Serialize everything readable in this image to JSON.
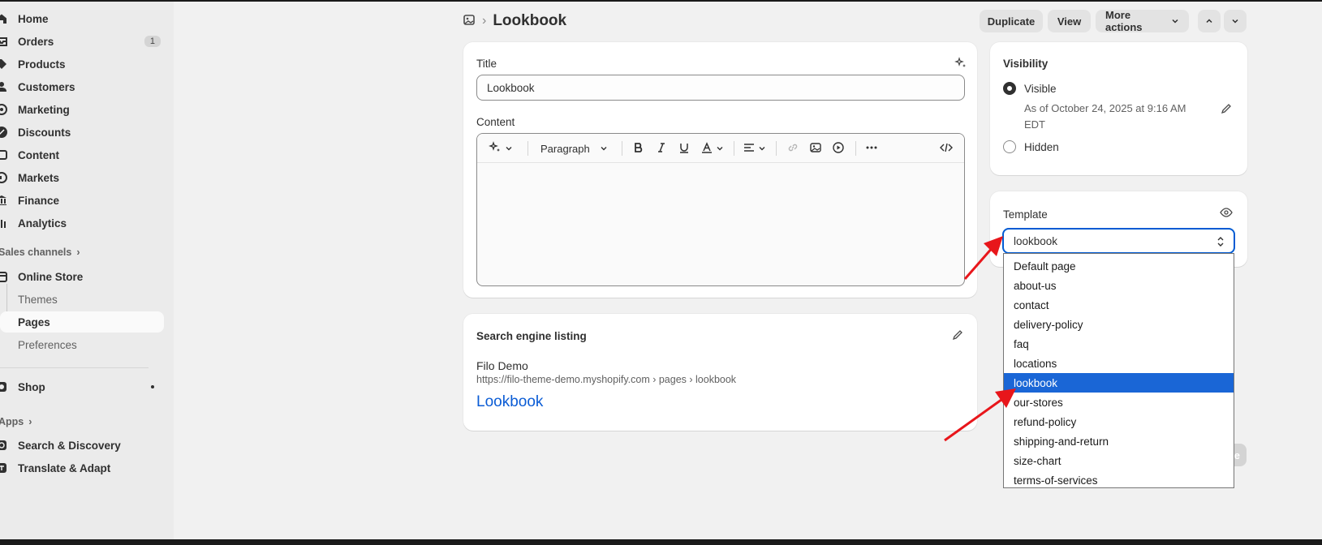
{
  "sidebar": {
    "items": [
      {
        "label": "Home",
        "icon": "home-icon"
      },
      {
        "label": "Orders",
        "icon": "orders-icon",
        "badge": "1"
      },
      {
        "label": "Products",
        "icon": "tag-icon"
      },
      {
        "label": "Customers",
        "icon": "person-icon"
      },
      {
        "label": "Marketing",
        "icon": "target-icon"
      },
      {
        "label": "Discounts",
        "icon": "discount-icon"
      },
      {
        "label": "Content",
        "icon": "image-icon"
      },
      {
        "label": "Markets",
        "icon": "globe-icon"
      },
      {
        "label": "Finance",
        "icon": "bank-icon"
      },
      {
        "label": "Analytics",
        "icon": "bar-chart-icon"
      }
    ],
    "sales_channels_label": "Sales channels",
    "online_store": {
      "label": "Online Store",
      "sub_items": [
        "Themes",
        "Pages",
        "Preferences"
      ],
      "active": "Pages"
    },
    "shop_label": "Shop",
    "apps_label": "Apps",
    "apps": [
      "Search & Discovery",
      "Translate & Adapt"
    ]
  },
  "header": {
    "title": "Lookbook",
    "buttons": {
      "duplicate": "Duplicate",
      "view": "View",
      "more_actions": "More actions"
    }
  },
  "main": {
    "title_label": "Title",
    "title_value": "Lookbook",
    "content_label": "Content",
    "paragraph_label": "Paragraph"
  },
  "seo": {
    "heading": "Search engine listing",
    "store_name": "Filo Demo",
    "url": "https://filo-theme-demo.myshopify.com › pages › lookbook",
    "page_title": "Lookbook"
  },
  "visibility": {
    "heading": "Visibility",
    "visible_label": "Visible",
    "visible_date": "As of October 24, 2025 at 9:16 AM",
    "visible_tz": "EDT",
    "hidden_label": "Hidden",
    "selected": "Visible"
  },
  "template": {
    "heading": "Template",
    "value": "lookbook",
    "options": [
      "Default page",
      "about-us",
      "contact",
      "delivery-policy",
      "faq",
      "locations",
      "lookbook",
      "our-stores",
      "refund-policy",
      "shipping-and-return",
      "size-chart",
      "terms-of-services"
    ],
    "selected_index": 6
  },
  "colors": {
    "accent": "#005bd3",
    "selected_option": "#1a66d6",
    "annotation_arrow": "#e8161b"
  }
}
